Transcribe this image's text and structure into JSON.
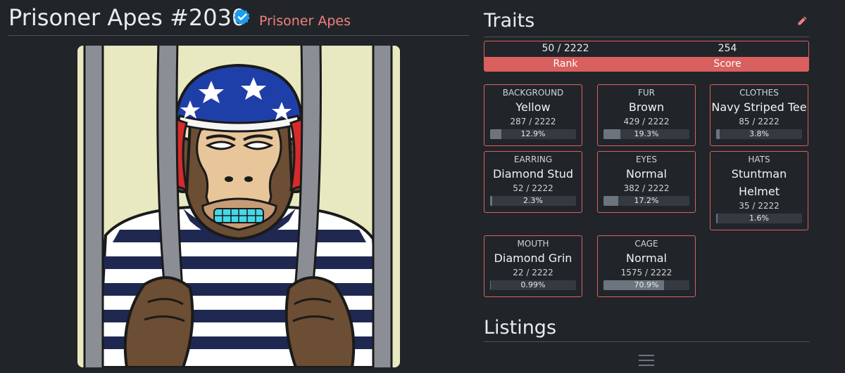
{
  "header": {
    "title": "Prisoner Apes #2030",
    "collection_link": "Prisoner Apes",
    "verified_color": "#1d9bf0",
    "collection_color": "#f08080"
  },
  "traits_section": {
    "title": "Traits",
    "rank_value": "50 / 2222",
    "score_value": "254",
    "rank_label": "Rank",
    "score_label": "Score",
    "accent_color": "#d9605f",
    "cards": [
      {
        "type": "BACKGROUND",
        "value": "Yellow",
        "count": "287 / 2222",
        "pct": "12.9%",
        "fraction": 0.129
      },
      {
        "type": "FUR",
        "value": "Brown",
        "count": "429 / 2222",
        "pct": "19.3%",
        "fraction": 0.193
      },
      {
        "type": "CLOTHES",
        "value": "Navy Striped Tee",
        "count": "85 / 2222",
        "pct": "3.8%",
        "fraction": 0.038
      },
      {
        "type": "EARRING",
        "value": "Diamond Stud",
        "count": "52 / 2222",
        "pct": "2.3%",
        "fraction": 0.023
      },
      {
        "type": "EYES",
        "value": "Normal",
        "count": "382 / 2222",
        "pct": "17.2%",
        "fraction": 0.172
      },
      {
        "type": "HATS",
        "value": "Stuntman Helmet",
        "count": "35 / 2222",
        "pct": "1.6%",
        "fraction": 0.016
      },
      {
        "type": "MOUTH",
        "value": "Diamond Grin",
        "count": "22 / 2222",
        "pct": "0.99%",
        "fraction": 0.0099
      },
      {
        "type": "CAGE",
        "value": "Normal",
        "count": "1575 / 2222",
        "pct": "70.9%",
        "fraction": 0.709
      }
    ]
  },
  "listings_section": {
    "title": "Listings",
    "menu_icon": "hamburger-menu-icon"
  },
  "icons": {
    "verified": "verified-badge-icon",
    "edit": "pencil-icon"
  }
}
